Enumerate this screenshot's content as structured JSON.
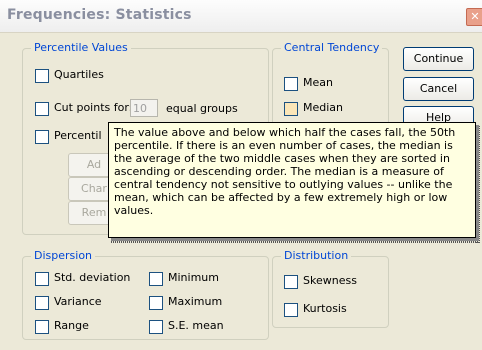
{
  "window": {
    "title": "Frequencies: Statistics",
    "close": "✕"
  },
  "percentile_values": {
    "legend": "Percentile Values",
    "quartiles": "Quartiles",
    "cut_points": "Cut points for:",
    "cut_points_value": "10",
    "equal_groups": "equal groups",
    "percentiles": "Percentil",
    "add": "Ad",
    "change": "Char",
    "remove": "Rem"
  },
  "central_tendency": {
    "legend": "Central Tendency",
    "mean": "Mean",
    "median": "Median"
  },
  "buttons": {
    "continue": "Continue",
    "cancel": "Cancel",
    "help": "Help"
  },
  "tooltip": {
    "text": "The value above and below which half the cases fall, the 50th percentile. If there is an even number of cases, the median is the average of the two middle cases when they are sorted in ascending or descending order. The median is a measure of central tendency not sensitive to outlying values -- unlike the mean, which can be affected by a few extremely high or low values."
  },
  "dispersion": {
    "legend": "Dispersion",
    "std_deviation": "Std. deviation",
    "minimum": "Minimum",
    "variance": "Variance",
    "maximum": "Maximum",
    "range": "Range",
    "se_mean": "S.E. mean"
  },
  "distribution": {
    "legend": "Distribution",
    "skewness": "Skewness",
    "kurtosis": "Kurtosis"
  }
}
